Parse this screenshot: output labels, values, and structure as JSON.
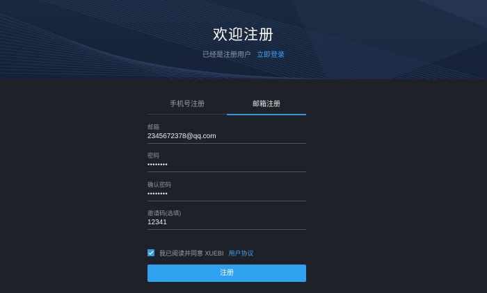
{
  "hero": {
    "title": "欢迎注册",
    "subtitle": "已经是注册用户",
    "login_link": "立即登录"
  },
  "tabs": [
    {
      "label": "手机号注册",
      "active": false
    },
    {
      "label": "邮箱注册",
      "active": true
    }
  ],
  "fields": {
    "email": {
      "label": "邮箱",
      "value": "2345672378@qq.com"
    },
    "password": {
      "label": "密码",
      "value": "••••••••"
    },
    "confirm_password": {
      "label": "确认密码",
      "value": "••••••••"
    },
    "invite_code": {
      "label": "邀请码(选填)",
      "value": "12341"
    }
  },
  "agreement": {
    "checked": true,
    "text": "我已阅读并同意 XUEBI",
    "link": "用户协议"
  },
  "submit_label": "注册",
  "colors": {
    "background": "#1f2128",
    "hero": "#16243b",
    "accent": "#2ea1ef"
  }
}
